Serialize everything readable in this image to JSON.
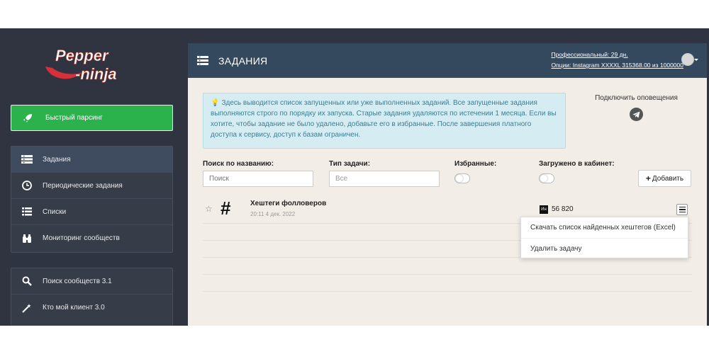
{
  "brand": {
    "logo_line1": "Pepper",
    "logo_line2": "-ninja"
  },
  "sidebar": {
    "quick_label": "Быстрый парсинг",
    "group1": [
      {
        "label": "Задания",
        "icon": "list-icon",
        "active": true
      },
      {
        "label": "Периодические задания",
        "icon": "clock-icon"
      },
      {
        "label": "Списки",
        "icon": "bullet-list-icon"
      },
      {
        "label": "Мониторинг сообществ",
        "icon": "binoculars-icon"
      }
    ],
    "group2": [
      {
        "label": "Поиск сообществ 3.1",
        "icon": "search-icon"
      },
      {
        "label": "Кто мой клиент 3.0",
        "icon": "magic-wand-icon"
      }
    ]
  },
  "header": {
    "title": "ЗАДАНИЯ",
    "plan_line1": "Профессиональный: 29 дн.",
    "plan_line2": "Опции: Instagram XXXXL 315368.00 из 1000000"
  },
  "info_text": "Здесь выводится список запущенных или уже выполненных заданий. Все запущенные задания выполняются строго по порядку их запуска. Старые задания удаляются по истечении 1 месяца. Если вы хотите, чтобы задание не было удалено, добавьте его в избранные. После завершения платного доступа к сервису, доступ к базам ограничен.",
  "notify": {
    "label": "Подключить оповещения"
  },
  "filters": {
    "search_label": "Поиск по названию:",
    "search_placeholder": "Поиск",
    "type_label": "Тип задачи:",
    "type_value": "Все",
    "favorites_label": "Избранные:",
    "uploaded_label": "Загружено в кабинет:",
    "add_label": "Добавить"
  },
  "task": {
    "name": "Хештеги фолловеров",
    "date": "20:11 4 дек. 2022",
    "badge": "Ин",
    "count": "56 820"
  },
  "dropdown": {
    "items": [
      "Скачать список найденных хештегов (Excel)",
      "Удалить задачу"
    ]
  },
  "colors": {
    "sidebar_bg": "#2f3440",
    "header_bg": "#34495e",
    "quick_green": "#2bb24c",
    "info_bg": "#d5ecf2",
    "info_text": "#3a7f93",
    "panel_bg": "#f3ede7"
  }
}
